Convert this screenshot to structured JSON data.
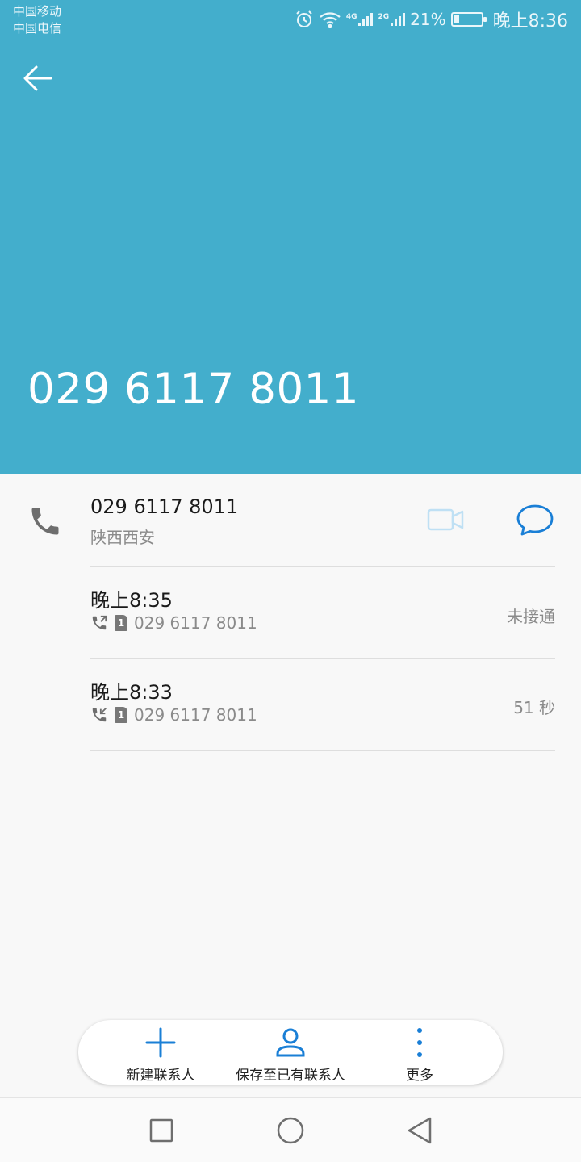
{
  "status_bar": {
    "carrier1": "中国移动",
    "carrier2": "中国电信",
    "sim1_network": "4G",
    "sim2_network": "2G",
    "battery_percent": "21%",
    "battery_level": 0.21,
    "time": "晚上8:36"
  },
  "header": {
    "title_number": "029 6117 8011",
    "background_color": "#43aecc"
  },
  "contact": {
    "number": "029 6117 8011",
    "location": "陕西西安"
  },
  "call_log": [
    {
      "time": "晚上8:35",
      "direction": "outgoing",
      "number": "029 6117 8011",
      "sim": "1",
      "status": "未接通"
    },
    {
      "time": "晚上8:33",
      "direction": "incoming",
      "number": "029 6117 8011",
      "sim": "1",
      "status": "51 秒"
    }
  ],
  "actions": {
    "new_contact": "新建联系人",
    "save_existing": "保存至已有联系人",
    "more": "更多",
    "accent_color": "#1a7fd6"
  }
}
